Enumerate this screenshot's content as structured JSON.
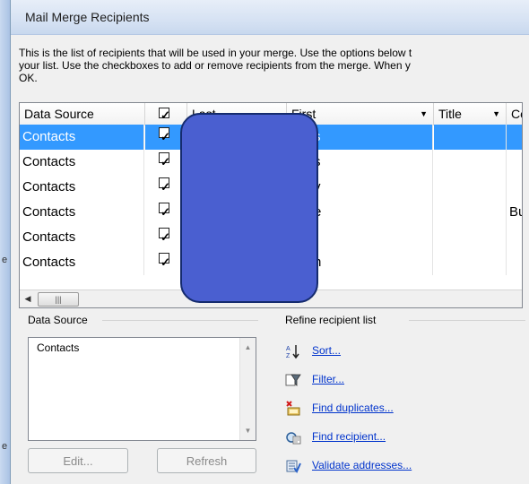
{
  "window": {
    "title": "Mail Merge Recipients"
  },
  "instructions": [
    "This is the list of recipients that will be used in your merge.  Use the options below t",
    "your list.  Use the checkboxes to add or remove recipients from the merge.  When y",
    "OK."
  ],
  "grid": {
    "headers": {
      "data_source": "Data Source",
      "last": "Last",
      "first": "First",
      "title": "Title",
      "company": "Co"
    },
    "rows": [
      {
        "source": "Contacts",
        "first_tail": "s",
        "company": "",
        "selected": true
      },
      {
        "source": "Contacts",
        "first_tail": "s",
        "company": "",
        "selected": false
      },
      {
        "source": "Contacts",
        "first_tail": "y",
        "company": "",
        "selected": false
      },
      {
        "source": "Contacts",
        "first_tail": "e",
        "company": "Bu",
        "selected": false
      },
      {
        "source": "Contacts",
        "first_tail": "i",
        "company": "",
        "selected": false
      },
      {
        "source": "Contacts",
        "first_tail": "h",
        "company": "",
        "selected": false
      }
    ]
  },
  "data_source_panel": {
    "label": "Data Source",
    "items": [
      "Contacts"
    ],
    "edit_label": "Edit...",
    "refresh_label": "Refresh"
  },
  "refine": {
    "label": "Refine recipient list",
    "links": [
      "Sort...",
      "Filter...",
      "Find duplicates...",
      "Find recipient...",
      "Validate addresses..."
    ]
  },
  "colors": {
    "selection": "#3399ff",
    "link": "#0033cc",
    "redaction": "#4a5fd0"
  }
}
